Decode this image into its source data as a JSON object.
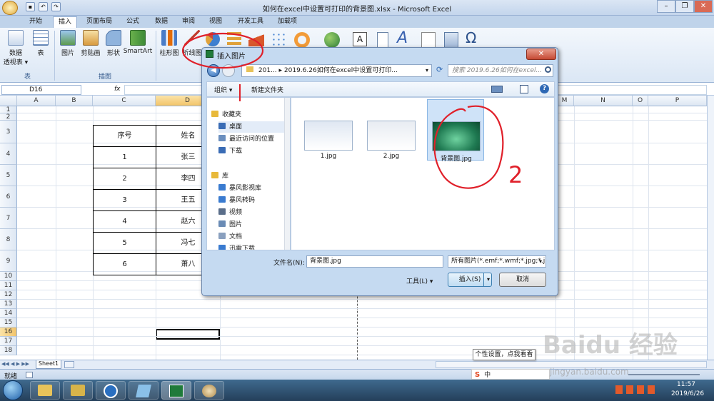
{
  "window": {
    "title": "如何在excel中设置可打印的背景图.xlsx - Microsoft Excel",
    "min": "–",
    "max": "❐",
    "close": "✕"
  },
  "tabs": [
    "开始",
    "插入",
    "页面布局",
    "公式",
    "数据",
    "审阅",
    "视图",
    "开发工具",
    "加载项"
  ],
  "ribbon": {
    "buttons": [
      {
        "label": "数据\n透视表 ▾"
      },
      {
        "label": "表"
      },
      {
        "label": "图片"
      },
      {
        "label": "剪贴画"
      },
      {
        "label": "形状"
      },
      {
        "label": "SmartArt"
      },
      {
        "label": "柱形图"
      },
      {
        "label": "折线图"
      }
    ],
    "groups": [
      "表",
      "插图"
    ]
  },
  "formula_bar": {
    "cell_ref": "D16",
    "fx": "fx"
  },
  "columns": [
    "A",
    "B",
    "C",
    "D",
    "M",
    "N",
    "O",
    "P"
  ],
  "rows": [
    "1",
    "2",
    "3",
    "4",
    "5",
    "6",
    "7",
    "8",
    "9",
    "10",
    "11",
    "12",
    "13",
    "14",
    "15",
    "16",
    "17",
    "18"
  ],
  "table": {
    "header": [
      "序号",
      "姓名"
    ],
    "rows": [
      [
        "1",
        "张三"
      ],
      [
        "2",
        "李四"
      ],
      [
        "3",
        "王五"
      ],
      [
        "4",
        "赵六"
      ],
      [
        "5",
        "冯七"
      ],
      [
        "6",
        "萧八"
      ]
    ]
  },
  "sheet_tab": "Sheet1",
  "status": "就绪",
  "dialog": {
    "title": "插入图片",
    "address_parts": [
      "201...",
      "2019.6.26如何在excel中设置可打印..."
    ],
    "search_placeholder": "搜索 2019.6.26如何在excel...",
    "organize": "组织 ▾",
    "new_folder": "新建文件夹",
    "nav": [
      {
        "label": "收藏夹",
        "color": "#e8b93a"
      },
      {
        "label": "桌面",
        "color": "#3a6cb5"
      },
      {
        "label": "最近访问的位置",
        "color": "#6b8fbf"
      },
      {
        "label": "下载",
        "color": "#3a6cb5"
      },
      {
        "label": "库",
        "color": "#e8b93a"
      },
      {
        "label": "暴风影视库",
        "color": "#3a7bd0"
      },
      {
        "label": "暴风转码",
        "color": "#3a7bd0"
      },
      {
        "label": "视频",
        "color": "#5a6e8a"
      },
      {
        "label": "图片",
        "color": "#6a8bb5"
      },
      {
        "label": "文档",
        "color": "#8aa0bf"
      },
      {
        "label": "迅雷下载",
        "color": "#3a7bd0"
      }
    ],
    "files": [
      {
        "name": "1.jpg",
        "color": "#dfe7f2",
        "selected": false
      },
      {
        "name": "2.jpg",
        "color": "#e8ecf2",
        "selected": false
      },
      {
        "name": "背景图.jpg",
        "color": "#1f7a52",
        "selected": true
      }
    ],
    "filename_label": "文件名(N):",
    "filename_value": "背景图.jpg",
    "filetype_value": "所有图片(*.emf;*.wmf;*.jpg;*.jpe",
    "tools_label": "工具(L) ▾",
    "insert_label": "插入(S)",
    "cancel_label": "取消"
  },
  "tooltip": "个性设置，点我看看",
  "annotation_number": "2",
  "watermark": "Baidu 经验",
  "watermark_url": "jingyan.baidu.com",
  "tray": {
    "time": "11:57",
    "date": "2019/6/26"
  }
}
